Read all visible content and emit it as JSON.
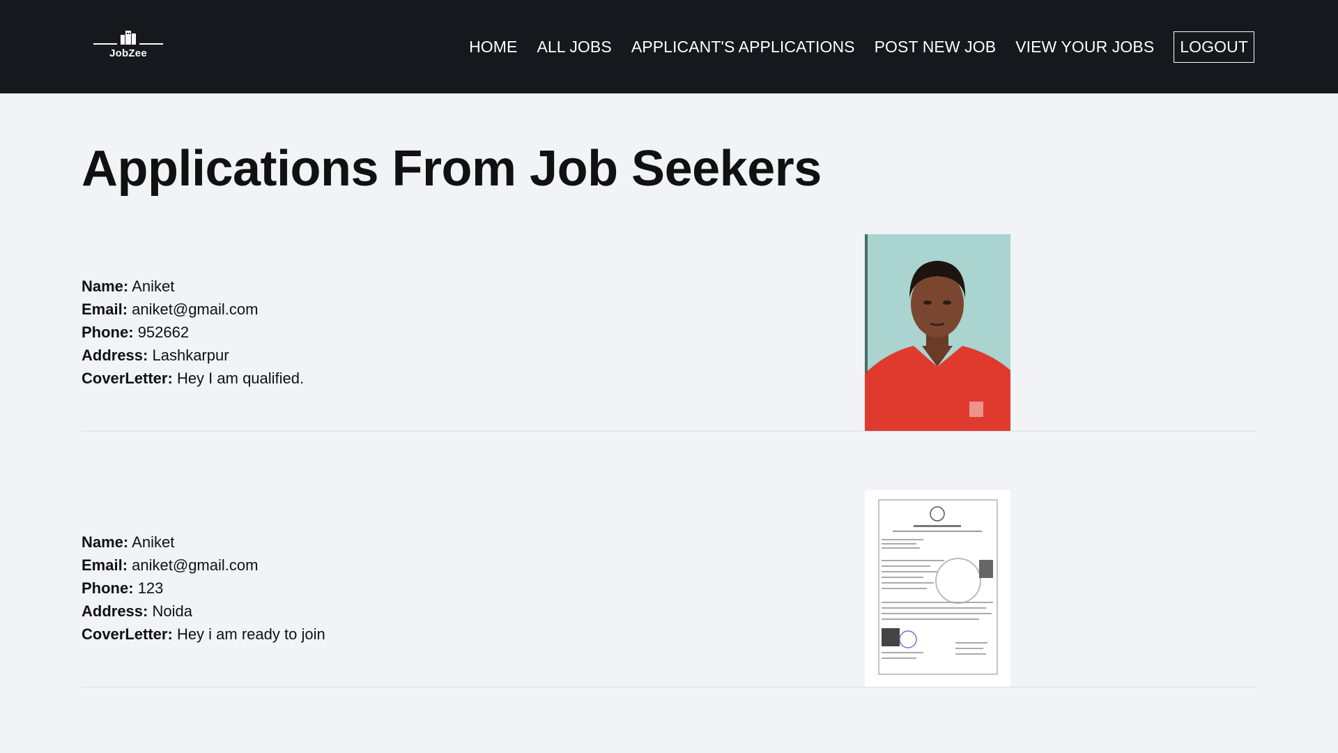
{
  "brand": {
    "name": "JobZee"
  },
  "nav": {
    "items": [
      {
        "label": "HOME"
      },
      {
        "label": "ALL JOBS"
      },
      {
        "label": "APPLICANT'S APPLICATIONS"
      },
      {
        "label": "POST NEW JOB"
      },
      {
        "label": "VIEW YOUR JOBS"
      }
    ],
    "logout": "LOGOUT"
  },
  "page": {
    "title": "Applications From Job Seekers"
  },
  "labels": {
    "name": "Name:",
    "email": "Email:",
    "phone": "Phone:",
    "address": "Address:",
    "cover_letter": "CoverLetter:"
  },
  "applications": [
    {
      "name": "Aniket",
      "email": "aniket@gmail.com",
      "phone": "952662",
      "address": "Lashkarpur",
      "cover_letter": "Hey I am qualified.",
      "resume_image": "photo-portrait"
    },
    {
      "name": "Aniket",
      "email": "aniket@gmail.com",
      "phone": "123",
      "address": "Noida",
      "cover_letter": "Hey i am ready to join",
      "resume_image": "document-scan"
    }
  ],
  "colors": {
    "navbar_bg": "#17181d",
    "page_bg": "#f1f3f6",
    "shirt": "#e03a2f",
    "photo_bg": "#a9d4cf"
  }
}
